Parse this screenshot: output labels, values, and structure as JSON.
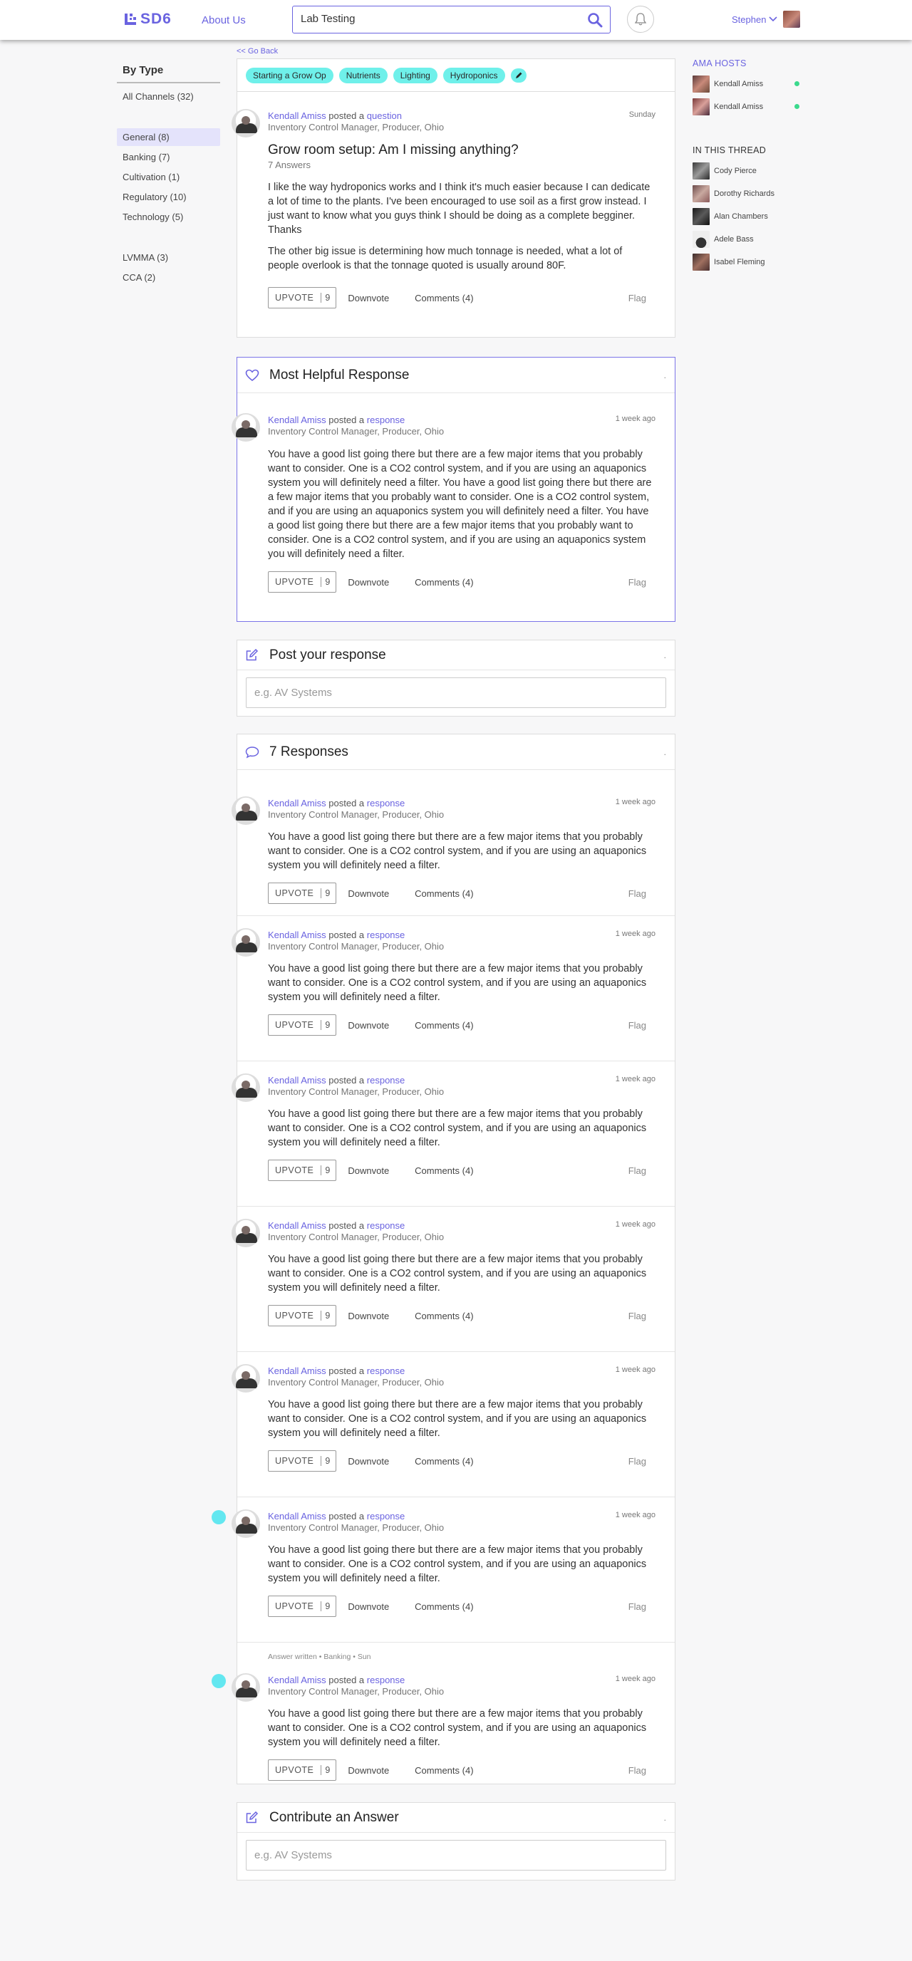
{
  "header": {
    "logo": "SD6",
    "about_label": "About Us",
    "search_value": "Lab Testing",
    "user_name": "Stephen"
  },
  "sidebar": {
    "title": "By Type",
    "all": "All Channels (32)",
    "group1": [
      "General (8)",
      "Banking (7)",
      "Cultivation (1)",
      "Regulatory (10)",
      "Technology (5)"
    ],
    "group2": [
      "LVMMA (3)",
      "CCA (2)"
    ]
  },
  "right": {
    "hosts_title": "AMA HOSTS",
    "hosts": [
      "Kendall Amiss",
      "Kendall Amiss"
    ],
    "thread_title": "IN THIS THREAD",
    "thread": [
      "Cody Pierce",
      "Dorothy Richards",
      "Alan Chambers",
      "Adele Bass",
      "Isabel Fleming"
    ]
  },
  "go_back": "<< Go Back",
  "tags": [
    "Starting a Grow Op",
    "Nutrients",
    "Lighting",
    "Hydroponics"
  ],
  "question": {
    "author": "Kendall Amiss",
    "posted_text": "posted a",
    "type": "question",
    "date": "Sunday",
    "role": "Inventory Control Manager, Producer, Ohio",
    "title": "Grow room setup: Am I missing anything?",
    "answers": "7 Answers",
    "p1": "I like the way hydroponics works and I think it's much easier because I can dedicate a lot of time to the plants. I've been encouraged to use soil as a first grow instead. I just want to know what you guys think I should be doing as a complete begginer. Thanks",
    "p2": "The other big issue is determining how much tonnage is needed, what a lot of people overlook is that the tonnage quoted is usually around 80F.",
    "upvote": "UPVOTE",
    "votes": "9",
    "downvote": "Downvote",
    "comments": "Comments (4)",
    "flag": "Flag"
  },
  "helpful": {
    "title": "Most Helpful Response",
    "dot": ".",
    "author": "Kendall Amiss",
    "posted_text": "posted a",
    "type": "response",
    "date": "1 week ago",
    "role": "Inventory Control Manager, Producer, Ohio",
    "text": "You have a good list going there but there are a few major items that you probably want to consider. One is a CO2 control system, and if you are using an aquaponics system you will definitely need a filter. You have a good list going there but there are a few major items that you probably want to consider. One is a CO2 control system, and if you are using an aquaponics system you will definitely need a filter. You have a good list going there but there are a few major items that you probably want to consider. One is a CO2 control system, and if you are using an aquaponics system you will definitely need a filter.",
    "upvote": "UPVOTE",
    "votes": "9",
    "downvote": "Downvote",
    "comments": "Comments (4)",
    "flag": "Flag"
  },
  "post_response": {
    "title": "Post your response",
    "dot": ".",
    "placeholder": "e.g. AV Systems"
  },
  "responses": {
    "title": "7 Responses",
    "dot": ".",
    "answer_note": "Answer written • Banking • Sun",
    "items": [
      {
        "author": "Kendall Amiss",
        "posted_text": "posted a",
        "type": "response",
        "date": "1 week ago",
        "role": "Inventory Control Manager, Producer, Ohio",
        "text": "You have a good list going there but there are a few major items that you probably want to consider. One is a CO2 control system, and if you are using an aquaponics system you will definitely need a filter.",
        "upvote": "UPVOTE",
        "votes": "9",
        "downvote": "Downvote",
        "comments": "Comments (4)",
        "flag": "Flag"
      },
      {
        "author": "Kendall Amiss",
        "posted_text": "posted a",
        "type": "response",
        "date": "1 week ago",
        "role": "Inventory Control Manager, Producer, Ohio",
        "text": "You have a good list going there but there are a few major items that you probably want to consider. One is a CO2 control system, and if you are using an aquaponics system you will definitely need a filter.",
        "upvote": "UPVOTE",
        "votes": "9",
        "downvote": "Downvote",
        "comments": "Comments (4)",
        "flag": "Flag"
      },
      {
        "author": "Kendall Amiss",
        "posted_text": "posted a",
        "type": "response",
        "date": "1 week ago",
        "role": "Inventory Control Manager, Producer, Ohio",
        "text": "You have a good list going there but there are a few major items that you probably want to consider. One is a CO2 control system, and if you are using an aquaponics system you will definitely need a filter.",
        "upvote": "UPVOTE",
        "votes": "9",
        "downvote": "Downvote",
        "comments": "Comments (4)",
        "flag": "Flag"
      },
      {
        "author": "Kendall Amiss",
        "posted_text": "posted a",
        "type": "response",
        "date": "1 week ago",
        "role": "Inventory Control Manager, Producer, Ohio",
        "text": "You have a good list going there but there are a few major items that you probably want to consider. One is a CO2 control system, and if you are using an aquaponics system you will definitely need a filter.",
        "upvote": "UPVOTE",
        "votes": "9",
        "downvote": "Downvote",
        "comments": "Comments (4)",
        "flag": "Flag"
      },
      {
        "author": "Kendall Amiss",
        "posted_text": "posted a",
        "type": "response",
        "date": "1 week ago",
        "role": "Inventory Control Manager, Producer, Ohio",
        "text": "You have a good list going there but there are a few major items that you probably want to consider. One is a CO2 control system, and if you are using an aquaponics system you will definitely need a filter.",
        "upvote": "UPVOTE",
        "votes": "9",
        "downvote": "Downvote",
        "comments": "Comments (4)",
        "flag": "Flag"
      },
      {
        "author": "Kendall Amiss",
        "posted_text": "posted a",
        "type": "response",
        "date": "1 week ago",
        "role": "Inventory Control Manager, Producer, Ohio",
        "text": "You have a good list going there but there are a few major items that you probably want to consider. One is a CO2 control system, and if you are using an aquaponics system you will definitely need a filter.",
        "upvote": "UPVOTE",
        "votes": "9",
        "downvote": "Downvote",
        "comments": "Comments (4)",
        "flag": "Flag"
      },
      {
        "author": "Kendall Amiss",
        "posted_text": "posted a",
        "type": "response",
        "date": "1 week ago",
        "role": "Inventory Control Manager, Producer, Ohio",
        "text": "You have a good list going there but there are a few major items that you probably want to consider. One is a CO2 control system, and if you are using an aquaponics system you will definitely need a filter.",
        "upvote": "UPVOTE",
        "votes": "9",
        "downvote": "Downvote",
        "comments": "Comments (4)",
        "flag": "Flag"
      }
    ]
  },
  "contribute": {
    "title": "Contribute an Answer",
    "dot": ".",
    "placeholder": "e.g. AV Systems"
  },
  "colors": {
    "accent": "#6a63e0",
    "tag": "#6ff0ea",
    "online": "#3bd98d",
    "cyan_marker": "#63e7f0"
  }
}
